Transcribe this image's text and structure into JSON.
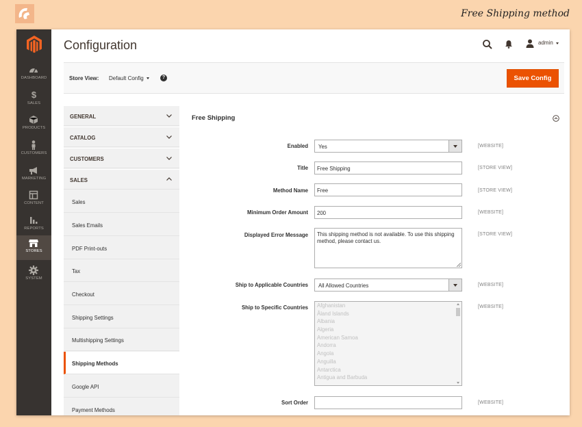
{
  "caption": "Free Shipping method",
  "colors": {
    "accent": "#eb5202",
    "sidebar_bg": "#373330",
    "sidebar_active": "#514943",
    "page_bg": "#fbd5ae"
  },
  "header": {
    "title": "Configuration",
    "user": "admin",
    "icons": [
      "search-icon",
      "bell-icon",
      "user-icon"
    ]
  },
  "admin_nav": {
    "items": [
      {
        "label": "DASHBOARD",
        "icon": "dashboard-icon"
      },
      {
        "label": "SALES",
        "icon": "dollar-icon"
      },
      {
        "label": "PRODUCTS",
        "icon": "cube-icon"
      },
      {
        "label": "CUSTOMERS",
        "icon": "person-icon"
      },
      {
        "label": "MARKETING",
        "icon": "megaphone-icon"
      },
      {
        "label": "CONTENT",
        "icon": "layout-icon"
      },
      {
        "label": "REPORTS",
        "icon": "bar-chart-icon"
      },
      {
        "label": "STORES",
        "icon": "store-icon",
        "active": true
      },
      {
        "label": "SYSTEM",
        "icon": "gear-icon"
      }
    ]
  },
  "store_view": {
    "label": "Store View:",
    "value": "Default Config",
    "save_label": "Save Config"
  },
  "config_tabs": {
    "groups": [
      {
        "label": "GENERAL",
        "expanded": false
      },
      {
        "label": "CATALOG",
        "expanded": false
      },
      {
        "label": "CUSTOMERS",
        "expanded": false
      },
      {
        "label": "SALES",
        "expanded": true
      }
    ],
    "sales_items": [
      {
        "label": "Sales"
      },
      {
        "label": "Sales Emails"
      },
      {
        "label": "PDF Print-outs"
      },
      {
        "label": "Tax"
      },
      {
        "label": "Checkout"
      },
      {
        "label": "Shipping Settings"
      },
      {
        "label": "Multishipping Settings"
      },
      {
        "label": "Shipping Methods",
        "active": true
      },
      {
        "label": "Google API"
      },
      {
        "label": "Payment Methods"
      }
    ]
  },
  "section": {
    "title": "Free Shipping",
    "fields": {
      "enabled": {
        "label": "Enabled",
        "value": "Yes",
        "scope": "[WEBSITE]"
      },
      "title": {
        "label": "Title",
        "value": "Free Shipping",
        "scope": "[STORE VIEW]"
      },
      "method_name": {
        "label": "Method Name",
        "value": "Free",
        "scope": "[STORE VIEW]"
      },
      "min_order": {
        "label": "Minimum Order Amount",
        "value": "200",
        "scope": "[WEBSITE]"
      },
      "error_message": {
        "label": "Displayed Error Message",
        "value": "This shipping method is not available. To use this shipping method, please contact us.",
        "scope": "[STORE VIEW]"
      },
      "applicable_countries": {
        "label": "Ship to Applicable Countries",
        "value": "All Allowed Countries",
        "scope": "[WEBSITE]"
      },
      "specific_countries": {
        "label": "Ship to Specific Countries",
        "scope": "[WEBSITE]",
        "options": [
          "Afghanistan",
          "Åland Islands",
          "Albania",
          "Algeria",
          "American Samoa",
          "Andorra",
          "Angola",
          "Anguilla",
          "Antarctica",
          "Antigua and Barbuda"
        ]
      },
      "sort_order": {
        "label": "Sort Order",
        "value": "",
        "scope": "[WEBSITE]"
      }
    }
  }
}
